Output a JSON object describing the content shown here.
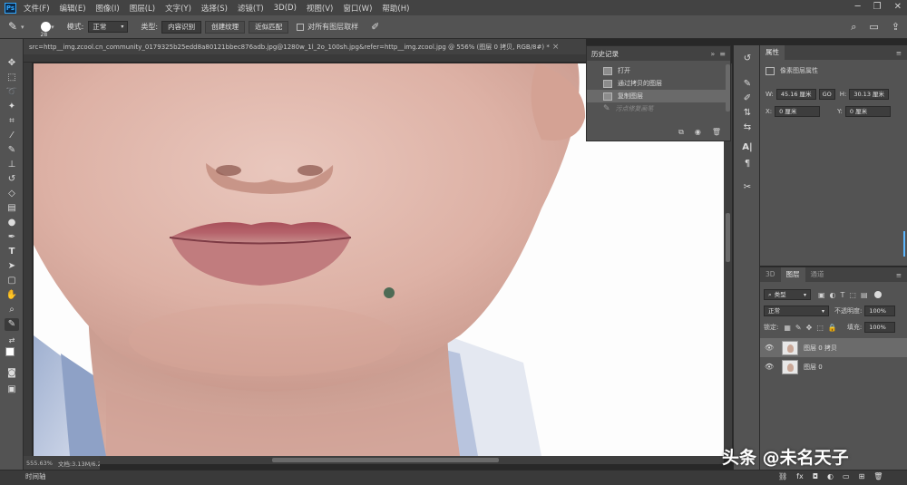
{
  "menubar": {
    "logo": "Ps",
    "items": [
      "文件(F)",
      "编辑(E)",
      "图像(I)",
      "图层(L)",
      "文字(Y)",
      "选择(S)",
      "滤镜(T)",
      "3D(D)",
      "视图(V)",
      "窗口(W)",
      "帮助(H)"
    ]
  },
  "options": {
    "brush_size": "28",
    "mode_label": "模式:",
    "mode_value": "正常",
    "type_label": "类型:",
    "type_buttons": [
      "内容识别",
      "创建纹理",
      "近似匹配"
    ],
    "sample_all_label": "对所有图层取样"
  },
  "document": {
    "tab_title": "src=http__img.zcool.cn_community_0179325b25edd8a80121bbec876adb.jpg@1280w_1l_2o_100sh.jpg&refer=http__img.zcool.jpg @ 556% (图层 0 拷贝, RGB/8#) *",
    "close": "×"
  },
  "status": {
    "zoom": "555.63%",
    "doc_size": "文档:3.13M/6.29M"
  },
  "timeline": {
    "label": "时间轴"
  },
  "history": {
    "title": "历史记录",
    "items": [
      {
        "label": "打开",
        "state": "normal"
      },
      {
        "label": "通过拷贝的图层",
        "state": "normal"
      },
      {
        "label": "复制图层",
        "state": "selected"
      },
      {
        "label": "污点修复画笔",
        "state": "dim"
      }
    ]
  },
  "properties": {
    "tab": "属性",
    "subtitle": "像素图层属性",
    "w_label": "W:",
    "w_value": "45.16 厘米",
    "link": "GO",
    "h_label": "H:",
    "h_value": "30.13 厘米",
    "x_label": "X:",
    "x_value": "0 厘米",
    "y_label": "Y:",
    "y_value": "0 厘米"
  },
  "layers": {
    "tabs": [
      "3D",
      "图层",
      "通道"
    ],
    "filter_value": "类型",
    "blend_mode": "正常",
    "opacity_label": "不透明度:",
    "opacity_value": "100%",
    "lock_label": "锁定:",
    "fill_label": "填充:",
    "fill_value": "100%",
    "items": [
      {
        "name": "图层 0 拷贝",
        "selected": true
      },
      {
        "name": "图层 0",
        "selected": false
      }
    ]
  },
  "watermark": {
    "text": "头条 @未名天子"
  },
  "colors": {
    "chrome_dark": "#282828",
    "panel": "#535353",
    "accent": "#31a8ff",
    "mole": "#4e6b55"
  }
}
